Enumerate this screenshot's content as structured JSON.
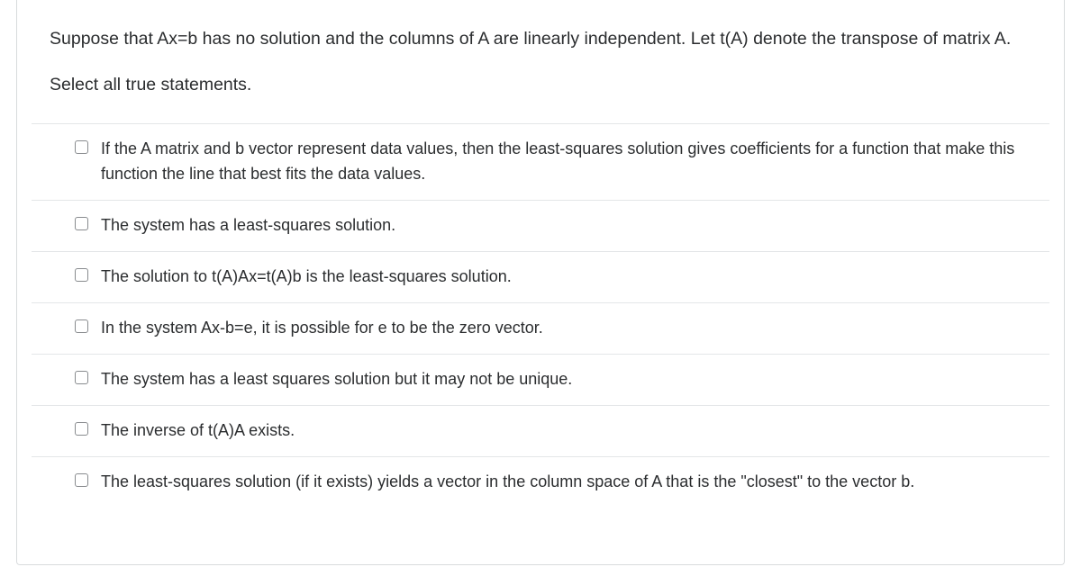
{
  "question": {
    "prompt": "Suppose that Ax=b has no solution and the columns of A are linearly independent. Let t(A) denote the transpose of matrix A.",
    "instruction": "Select all true statements."
  },
  "options": [
    {
      "label": "If the A matrix and b vector represent data values, then the least-squares solution gives coefficients for a function that make this function the line that best fits the data values."
    },
    {
      "label": "The system has a least-squares solution."
    },
    {
      "label": "The solution to t(A)Ax=t(A)b is the least-squares solution."
    },
    {
      "label": "In the system Ax-b=e, it is possible for e to be the zero vector."
    },
    {
      "label": "The system has a least squares solution but it may not be unique."
    },
    {
      "label": "The inverse of t(A)A exists."
    },
    {
      "label": "The least-squares solution (if it exists) yields a vector in the column space of A that is the \"closest\" to the vector b."
    }
  ]
}
